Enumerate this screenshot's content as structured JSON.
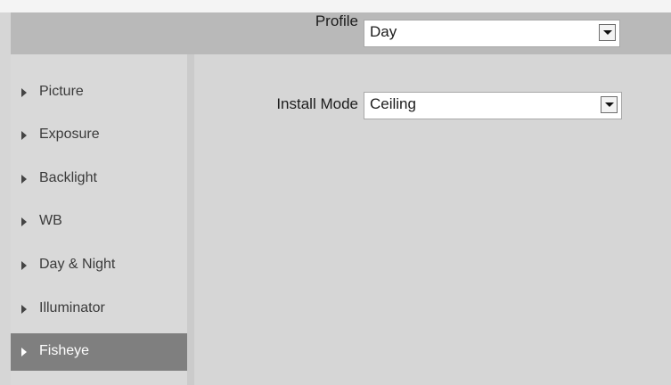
{
  "header": {
    "profile_label": "Profile",
    "profile_value": "Day"
  },
  "sidebar": {
    "items": [
      {
        "label": "Picture",
        "active": false
      },
      {
        "label": "Exposure",
        "active": false
      },
      {
        "label": "Backlight",
        "active": false
      },
      {
        "label": "WB",
        "active": false
      },
      {
        "label": "Day & Night",
        "active": false
      },
      {
        "label": "Illuminator",
        "active": false
      },
      {
        "label": "Fisheye",
        "active": true
      }
    ]
  },
  "main": {
    "install_mode_label": "Install Mode",
    "install_mode_value": "Ceiling"
  },
  "icons": {
    "dropdown": "chevron-down-icon",
    "sidebar_marker": "triangle-right-icon"
  },
  "colors": {
    "active_item_bg": "#7f7f7f",
    "profile_bar_bg": "#b9b9b9",
    "panel_bg": "#d6d6d6"
  }
}
